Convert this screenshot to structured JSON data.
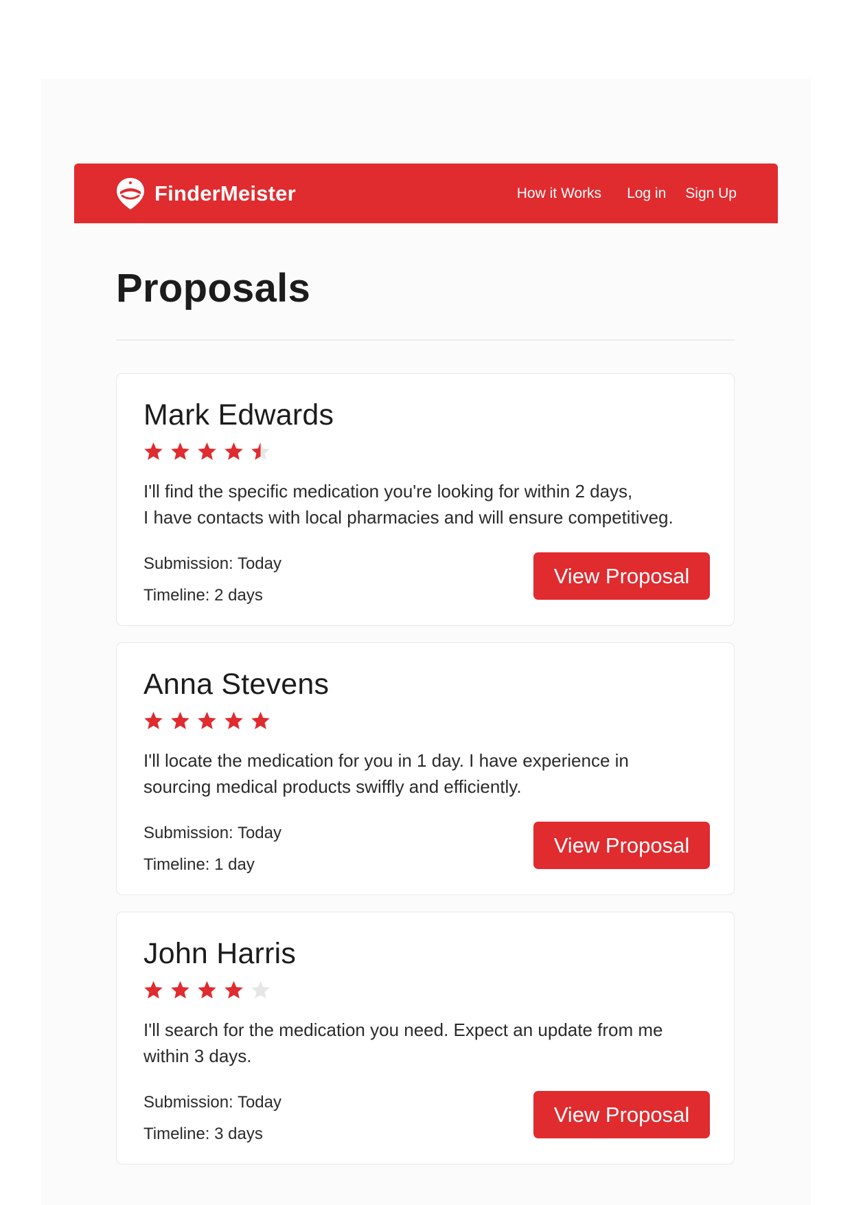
{
  "brand": {
    "name": "FinderMeister"
  },
  "nav": {
    "how_it_works": "How it Works",
    "log_in": "Log in",
    "sign_up": "Sign Up"
  },
  "page": {
    "title": "Proposals"
  },
  "colors": {
    "accent": "#e02b2f",
    "star_filled": "#e02b2f",
    "star_empty": "#e6e6e6"
  },
  "proposals": [
    {
      "name": "Mark Edwards",
      "rating": 4.5,
      "description_line1": "I'll find the specific  medication you're looking for within 2 days,",
      "description_line2": "I have contacts with local pharmacies and will ensure competitiveg.",
      "submission": "Submission: Today",
      "timeline": "Timeline: 2 days",
      "button_label": "View Proposal"
    },
    {
      "name": "Anna Stevens",
      "rating": 5,
      "description_line1": "I'll locate the  medication for you in 1 day. I have experience in",
      "description_line2": "sourcing medical products swiffly and efficiently.",
      "submission": "Submission: Today",
      "timeline": "Timeline: 1 day",
      "button_label": "View Proposal"
    },
    {
      "name": "John Harris",
      "rating": 4,
      "description_line1": "I'll search for the medication you need. Expect an update from me",
      "description_line2": "within 3 days.",
      "submission": "Submission: Today",
      "timeline": "Timeline: 3 days",
      "button_label": "View Proposal"
    }
  ]
}
